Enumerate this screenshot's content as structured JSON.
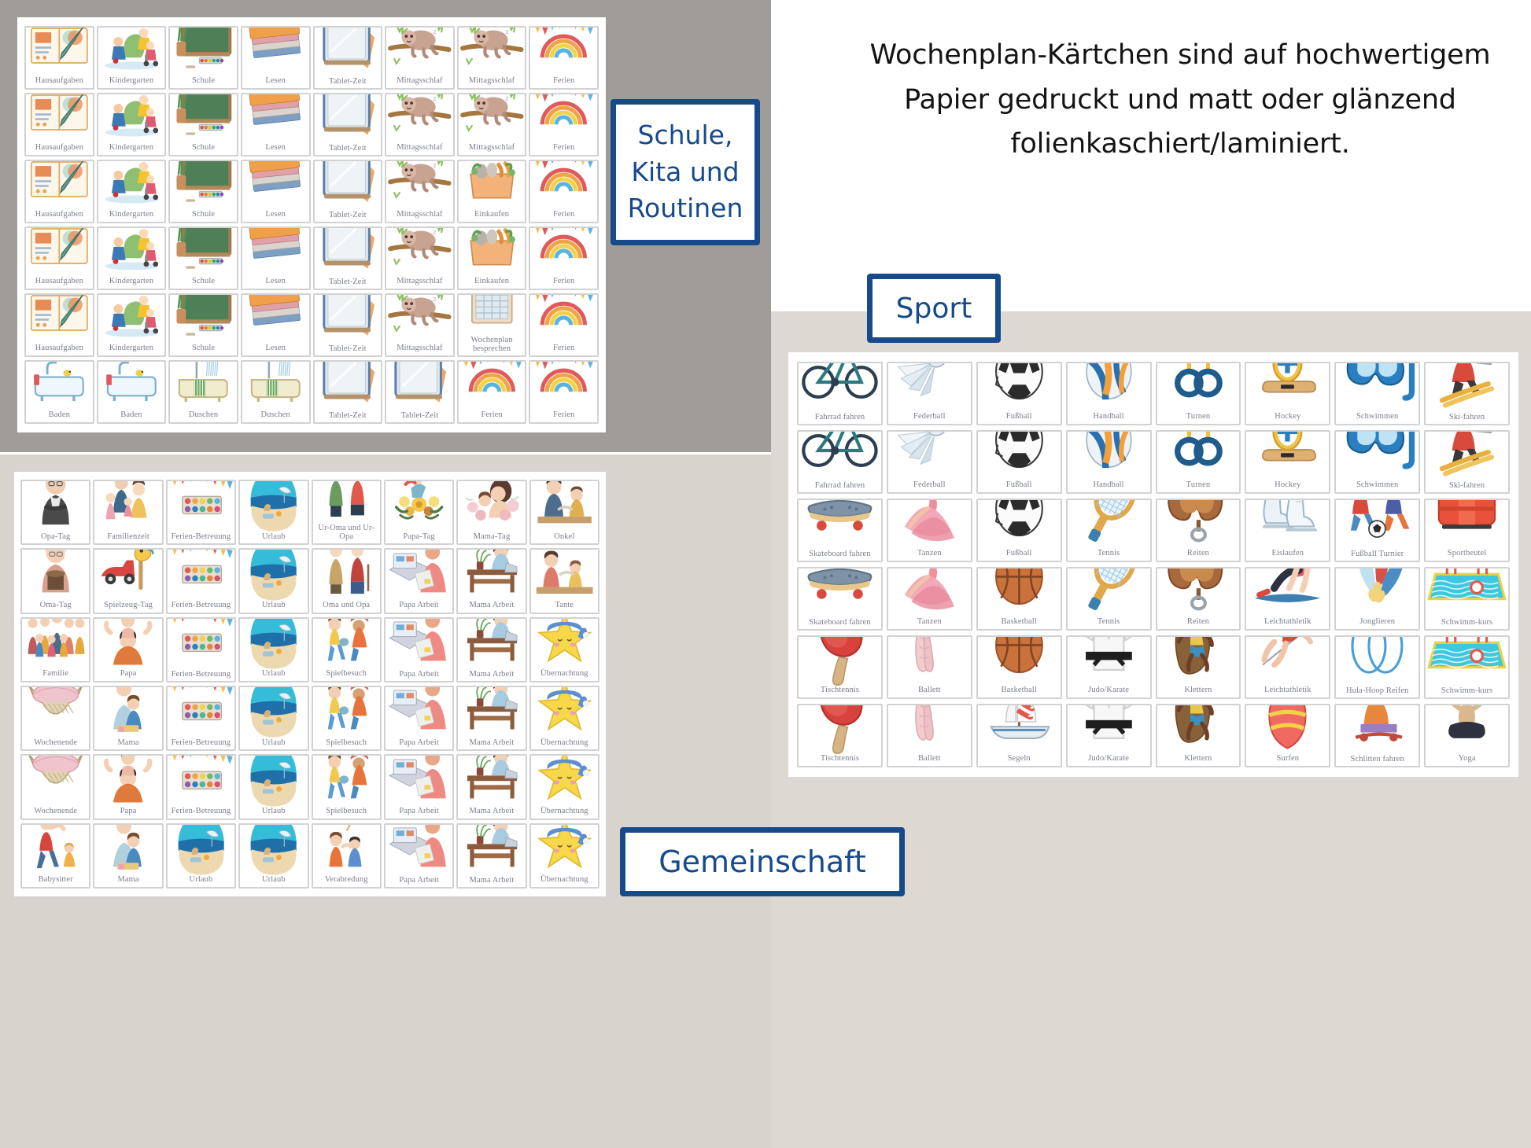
{
  "headline": "Wochenplan-Kärtchen sind auf hochwertigem Papier gedruckt und matt oder glänzend folienkaschiert/laminiert.",
  "labels": {
    "school_box": "Schule,\nKita und\nRoutinen",
    "sport_box": "Sport",
    "community_box": "Gemeinschaft"
  },
  "colors": {
    "blue_accent": "#174a8b",
    "card_border": "#d2d2d2",
    "card_label_text": "#7b7f8c",
    "panel_gray": "#a09c97",
    "panel_beige": "#d9d3cd",
    "panel_beige_right": "#ded8d2"
  },
  "school_grid": {
    "columns": 8,
    "rows": 6,
    "cards": [
      [
        {
          "label": "Hausaufgaben",
          "icon": "homework-book-icon"
        },
        {
          "label": "Kindergarten",
          "icon": "kindergarten-kids-icon"
        },
        {
          "label": "Schule",
          "icon": "chalkboard-icon"
        },
        {
          "label": "Lesen",
          "icon": "book-stack-icon"
        },
        {
          "label": "Tablet-Zeit",
          "icon": "tablet-icon"
        },
        {
          "label": "Mittagsschlaf",
          "icon": "sloth-icon"
        },
        {
          "label": "Mittagsschlaf",
          "icon": "sloth-icon"
        },
        {
          "label": "Ferien",
          "icon": "rainbow-bunting-icon"
        }
      ],
      [
        {
          "label": "Hausaufgaben",
          "icon": "homework-book-icon"
        },
        {
          "label": "Kindergarten",
          "icon": "kindergarten-kids-icon"
        },
        {
          "label": "Schule",
          "icon": "chalkboard-icon"
        },
        {
          "label": "Lesen",
          "icon": "book-stack-icon"
        },
        {
          "label": "Tablet-Zeit",
          "icon": "tablet-icon"
        },
        {
          "label": "Mittagsschlaf",
          "icon": "sloth-icon"
        },
        {
          "label": "Mittagsschlaf",
          "icon": "sloth-icon"
        },
        {
          "label": "Ferien",
          "icon": "rainbow-bunting-icon"
        }
      ],
      [
        {
          "label": "Hausaufgaben",
          "icon": "homework-book-icon"
        },
        {
          "label": "Kindergarten",
          "icon": "kindergarten-kids-icon"
        },
        {
          "label": "Schule",
          "icon": "chalkboard-icon"
        },
        {
          "label": "Lesen",
          "icon": "book-stack-icon"
        },
        {
          "label": "Tablet-Zeit",
          "icon": "tablet-icon"
        },
        {
          "label": "Mittagsschlaf",
          "icon": "sloth-icon"
        },
        {
          "label": "Einkaufen",
          "icon": "grocery-bag-icon"
        },
        {
          "label": "Ferien",
          "icon": "rainbow-bunting-icon"
        }
      ],
      [
        {
          "label": "Hausaufgaben",
          "icon": "homework-book-icon"
        },
        {
          "label": "Kindergarten",
          "icon": "kindergarten-kids-icon"
        },
        {
          "label": "Schule",
          "icon": "chalkboard-icon"
        },
        {
          "label": "Lesen",
          "icon": "book-stack-icon"
        },
        {
          "label": "Tablet-Zeit",
          "icon": "tablet-icon"
        },
        {
          "label": "Mittagsschlaf",
          "icon": "sloth-icon"
        },
        {
          "label": "Einkaufen",
          "icon": "grocery-bag-icon"
        },
        {
          "label": "Ferien",
          "icon": "rainbow-bunting-icon"
        }
      ],
      [
        {
          "label": "Hausaufgaben",
          "icon": "homework-book-icon"
        },
        {
          "label": "Kindergarten",
          "icon": "kindergarten-kids-icon"
        },
        {
          "label": "Schule",
          "icon": "chalkboard-icon"
        },
        {
          "label": "Lesen",
          "icon": "book-stack-icon"
        },
        {
          "label": "Tablet-Zeit",
          "icon": "tablet-icon"
        },
        {
          "label": "Mittagsschlaf",
          "icon": "sloth-icon"
        },
        {
          "label": "Wochenplan besprechen",
          "icon": "notepad-icon"
        },
        {
          "label": "Ferien",
          "icon": "rainbow-bunting-icon"
        }
      ],
      [
        {
          "label": "Baden",
          "icon": "bathtub-icon"
        },
        {
          "label": "Baden",
          "icon": "bathtub-icon"
        },
        {
          "label": "Duschen",
          "icon": "shower-icon"
        },
        {
          "label": "Duschen",
          "icon": "shower-icon"
        },
        {
          "label": "Tablet-Zeit",
          "icon": "tablet-icon"
        },
        {
          "label": "Tablet-Zeit",
          "icon": "tablet-icon"
        },
        {
          "label": "Ferien",
          "icon": "rainbow-bunting-icon"
        },
        {
          "label": "Ferien",
          "icon": "rainbow-bunting-icon"
        }
      ]
    ]
  },
  "community_grid": {
    "columns": 8,
    "rows": 6,
    "cards": [
      [
        {
          "label": "Opa-Tag",
          "icon": "grandfather-icon"
        },
        {
          "label": "Familienzeit",
          "icon": "family-group-icon"
        },
        {
          "label": "Ferien-Betreuung",
          "icon": "bunting-paint-icon"
        },
        {
          "label": "Urlaub",
          "icon": "beach-icon"
        },
        {
          "label": "Ur-Oma und Ur-Opa",
          "icon": "great-grandparents-icon"
        },
        {
          "label": "Papa-Tag",
          "icon": "flowers-dad-icon"
        },
        {
          "label": "Mama-Tag",
          "icon": "mother-child-icon"
        },
        {
          "label": "Onkel",
          "icon": "uncle-icon"
        }
      ],
      [
        {
          "label": "Oma-Tag",
          "icon": "grandmother-icon"
        },
        {
          "label": "Spielzeug-Tag",
          "icon": "toy-car-icon"
        },
        {
          "label": "Ferien-Betreuung",
          "icon": "bunting-paint-icon"
        },
        {
          "label": "Urlaub",
          "icon": "beach-icon"
        },
        {
          "label": "Oma und Opa",
          "icon": "grandparents-icon"
        },
        {
          "label": "Papa Arbeit",
          "icon": "dad-working-icon"
        },
        {
          "label": "Mama Arbeit",
          "icon": "mom-desk-icon"
        },
        {
          "label": "Tante",
          "icon": "aunt-icon"
        }
      ],
      [
        {
          "label": "Familie",
          "icon": "big-family-icon"
        },
        {
          "label": "Papa",
          "icon": "dad-shoulders-icon"
        },
        {
          "label": "Ferien-Betreuung",
          "icon": "bunting-paint-icon"
        },
        {
          "label": "Urlaub",
          "icon": "beach-icon"
        },
        {
          "label": "Spielbesuch",
          "icon": "playdate-icon"
        },
        {
          "label": "Papa Arbeit",
          "icon": "dad-working-icon"
        },
        {
          "label": "Mama Arbeit",
          "icon": "mom-desk-icon"
        },
        {
          "label": "Übernachtung",
          "icon": "sleeping-star-icon"
        }
      ],
      [
        {
          "label": "Wochenende",
          "icon": "hammock-icon"
        },
        {
          "label": "Mama",
          "icon": "mom-hug-icon"
        },
        {
          "label": "Ferien-Betreuung",
          "icon": "bunting-paint-icon"
        },
        {
          "label": "Urlaub",
          "icon": "beach-icon"
        },
        {
          "label": "Spielbesuch",
          "icon": "playdate-icon"
        },
        {
          "label": "Papa Arbeit",
          "icon": "dad-working-icon"
        },
        {
          "label": "Mama Arbeit",
          "icon": "mom-desk-icon"
        },
        {
          "label": "Übernachtung",
          "icon": "sleeping-star-icon"
        }
      ],
      [
        {
          "label": "Wochenende",
          "icon": "hammock-icon"
        },
        {
          "label": "Papa",
          "icon": "dad-shoulders-icon"
        },
        {
          "label": "Ferien-Betreuung",
          "icon": "bunting-paint-icon"
        },
        {
          "label": "Urlaub",
          "icon": "beach-icon"
        },
        {
          "label": "Spielbesuch",
          "icon": "playdate-icon"
        },
        {
          "label": "Papa Arbeit",
          "icon": "dad-working-icon"
        },
        {
          "label": "Mama Arbeit",
          "icon": "mom-desk-icon"
        },
        {
          "label": "Übernachtung",
          "icon": "sleeping-star-icon"
        }
      ],
      [
        {
          "label": "Babysitter",
          "icon": "babysitter-icon"
        },
        {
          "label": "Mama",
          "icon": "mom-hug-icon"
        },
        {
          "label": "Urlaub",
          "icon": "beach-icon"
        },
        {
          "label": "Urlaub",
          "icon": "beach-icon"
        },
        {
          "label": "Verabredung",
          "icon": "meetup-icon"
        },
        {
          "label": "Papa Arbeit",
          "icon": "dad-working-icon"
        },
        {
          "label": "Mama Arbeit",
          "icon": "mom-desk-icon"
        },
        {
          "label": "Übernachtung",
          "icon": "sleeping-star-icon"
        }
      ]
    ]
  },
  "sport_grid": {
    "columns": 8,
    "rows": 6,
    "cards": [
      [
        {
          "label": "Fahrrad fahren",
          "icon": "bicycle-icon"
        },
        {
          "label": "Federball",
          "icon": "shuttlecock-icon"
        },
        {
          "label": "Fußball",
          "icon": "soccer-ball-icon"
        },
        {
          "label": "Handball",
          "icon": "handball-icon"
        },
        {
          "label": "Turnen",
          "icon": "gym-rings-icon"
        },
        {
          "label": "Hockey",
          "icon": "hockey-icon"
        },
        {
          "label": "Schwimmen",
          "icon": "diving-mask-icon"
        },
        {
          "label": "Ski-fahren",
          "icon": "skier-icon"
        }
      ],
      [
        {
          "label": "Fahrrad fahren",
          "icon": "bicycle-icon"
        },
        {
          "label": "Federball",
          "icon": "shuttlecock-icon"
        },
        {
          "label": "Fußball",
          "icon": "soccer-ball-icon"
        },
        {
          "label": "Handball",
          "icon": "handball-icon"
        },
        {
          "label": "Turnen",
          "icon": "gym-rings-icon"
        },
        {
          "label": "Hockey",
          "icon": "hockey-icon"
        },
        {
          "label": "Schwimmen",
          "icon": "diving-mask-icon"
        },
        {
          "label": "Ski-fahren",
          "icon": "skier-icon"
        }
      ],
      [
        {
          "label": "Skateboard fahren",
          "icon": "skateboard-icon"
        },
        {
          "label": "Tanzen",
          "icon": "dancer-icon"
        },
        {
          "label": "Fußball",
          "icon": "soccer-ball-icon"
        },
        {
          "label": "Tennis",
          "icon": "tennis-racket-icon"
        },
        {
          "label": "Reiten",
          "icon": "saddle-icon"
        },
        {
          "label": "Eislaufen",
          "icon": "ice-skates-icon"
        },
        {
          "label": "Fußball Turnier",
          "icon": "soccer-kids-icon"
        },
        {
          "label": "Sportbeutel",
          "icon": "sports-bag-icon"
        }
      ],
      [
        {
          "label": "Skateboard fahren",
          "icon": "skateboard-icon"
        },
        {
          "label": "Tanzen",
          "icon": "dancer-icon"
        },
        {
          "label": "Basketball",
          "icon": "basketball-icon"
        },
        {
          "label": "Tennis",
          "icon": "tennis-racket-icon"
        },
        {
          "label": "Reiten",
          "icon": "saddle-icon"
        },
        {
          "label": "Leichtathletik",
          "icon": "plank-exercise-icon"
        },
        {
          "label": "Jonglieren",
          "icon": "juggling-clubs-icon"
        },
        {
          "label": "Schwimm-kurs",
          "icon": "swimming-pool-icon"
        }
      ],
      [
        {
          "label": "Tischtennis",
          "icon": "table-tennis-icon"
        },
        {
          "label": "Ballett",
          "icon": "ballet-shoes-icon"
        },
        {
          "label": "Basketball",
          "icon": "basketball-icon"
        },
        {
          "label": "Judo/Karate",
          "icon": "judo-gi-icon"
        },
        {
          "label": "Klettern",
          "icon": "climbing-icon"
        },
        {
          "label": "Leichtathletik",
          "icon": "high-jump-icon"
        },
        {
          "label": "Hula-Hoop Reifen",
          "icon": "hula-hoop-icon"
        },
        {
          "label": "Schwimm-kurs",
          "icon": "swimming-pool-icon"
        }
      ],
      [
        {
          "label": "Tischtennis",
          "icon": "table-tennis-icon"
        },
        {
          "label": "Ballett",
          "icon": "ballet-shoes-icon"
        },
        {
          "label": "Segeln",
          "icon": "sailboat-icon"
        },
        {
          "label": "Judo/Karate",
          "icon": "judo-gi-icon"
        },
        {
          "label": "Klettern",
          "icon": "climbing-icon"
        },
        {
          "label": "Surfen",
          "icon": "surfboard-icon"
        },
        {
          "label": "Schlitten fahren",
          "icon": "sledding-icon"
        },
        {
          "label": "Yoga",
          "icon": "yoga-icon"
        }
      ]
    ]
  }
}
